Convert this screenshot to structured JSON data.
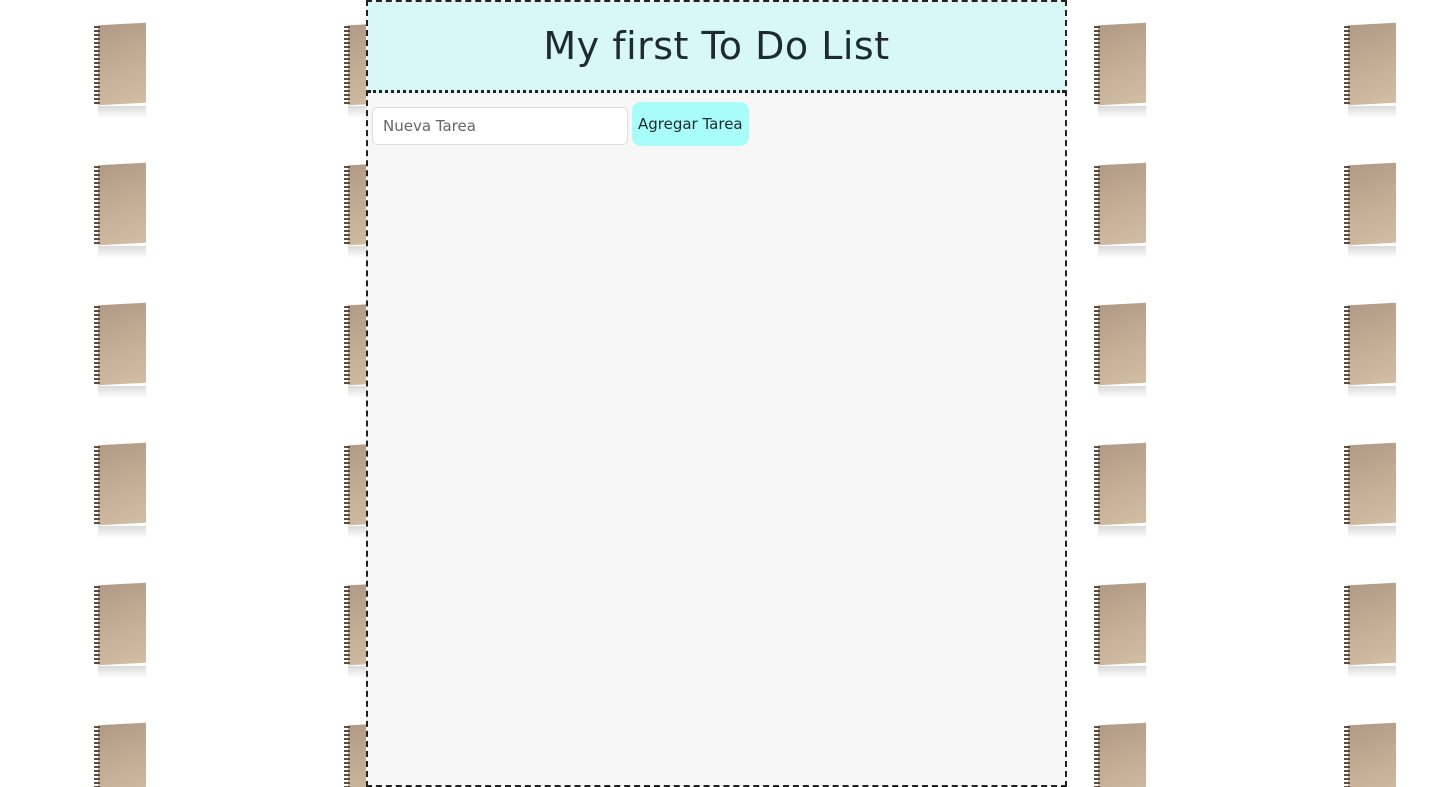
{
  "header": {
    "title": "My first To Do List"
  },
  "form": {
    "input_value": "",
    "input_placeholder": "Nueva Tarea",
    "add_button_label": "Agregar Tarea"
  },
  "tasks": [],
  "background": {
    "pattern_icon": "notebook-icon"
  },
  "colors": {
    "header_bg": "#d8f8f8",
    "button_bg": "#a8fcfa",
    "panel_bg": "#f7f7f7",
    "border": "#222222"
  }
}
